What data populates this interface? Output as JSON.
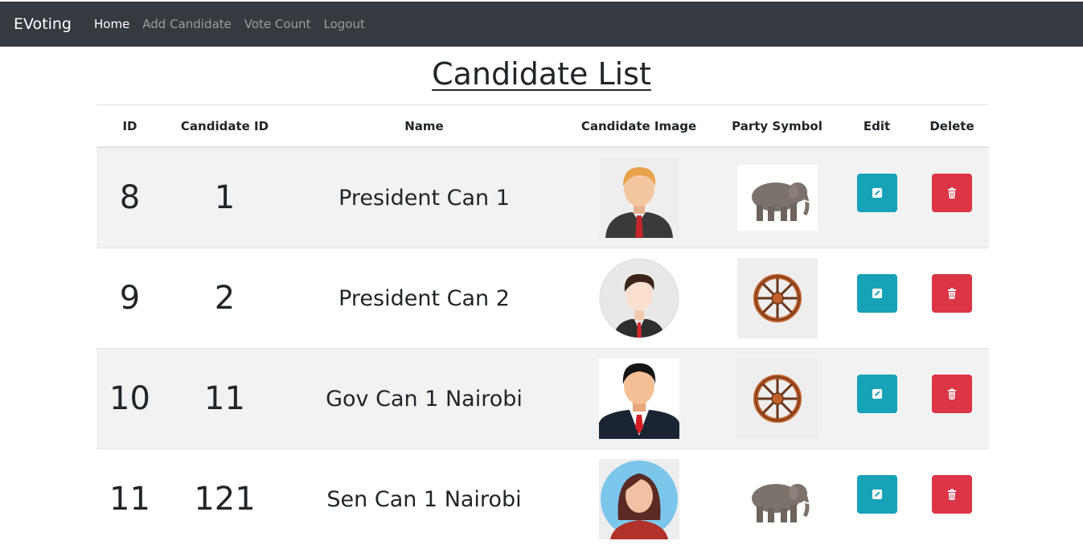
{
  "nav": {
    "brand": "EVoting",
    "links": [
      {
        "label": "Home",
        "active": true
      },
      {
        "label": "Add Candidate",
        "active": false
      },
      {
        "label": "Vote Count",
        "active": false
      },
      {
        "label": "Logout",
        "active": false
      }
    ]
  },
  "page_title": "Candidate List",
  "table": {
    "headers": [
      "ID",
      "Candidate ID",
      "Name",
      "Candidate Image",
      "Party Symbol",
      "Edit",
      "Delete"
    ],
    "rows": [
      {
        "id": "8",
        "candidate_id": "1",
        "name": "President Can 1",
        "image": "male-avatar-blond-icon",
        "symbol": "elephant-icon"
      },
      {
        "id": "9",
        "candidate_id": "2",
        "name": "President Can 2",
        "image": "male-avatar-round-icon",
        "symbol": "wheel-icon"
      },
      {
        "id": "10",
        "candidate_id": "11",
        "name": "Gov Can 1 Nairobi",
        "image": "male-avatar-suit-icon",
        "symbol": "wheel-icon"
      },
      {
        "id": "11",
        "candidate_id": "121",
        "name": "Sen Can 1 Nairobi",
        "image": "female-avatar-icon",
        "symbol": "elephant-icon"
      }
    ]
  },
  "colors": {
    "navbar": "#343a40",
    "edit_button": "#17a2b8",
    "delete_button": "#dc3545",
    "row_stripe": "#f2f2f2"
  }
}
